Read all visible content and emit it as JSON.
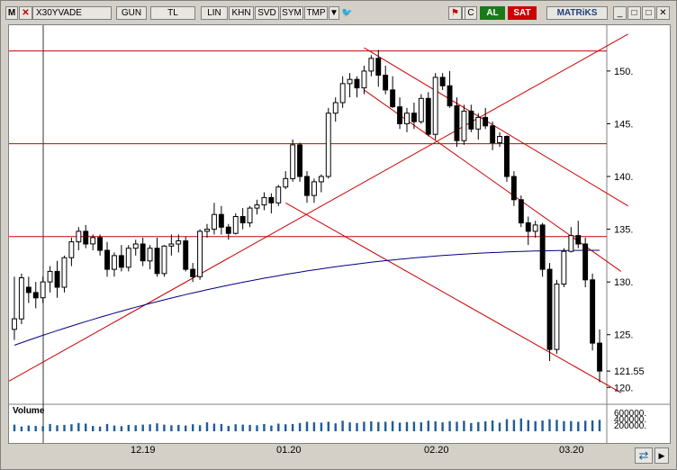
{
  "toolbar": {
    "menu_letter": "M",
    "symbol": "X30YVADE",
    "period": "GUN",
    "currency": "TL",
    "scale": "LIN",
    "btn_khn": "KHN",
    "btn_svd": "SVD",
    "btn_sym": "SYM",
    "btn_tmp": "TMP",
    "al_label": "AL",
    "sat_label": "SAT",
    "brand": "MATRiKS"
  },
  "colors": {
    "bullish": "#ffffff",
    "bearish": "#000000",
    "trendline": "#cc0000",
    "moving_average": "#000080",
    "volume": "#1f5c99",
    "al": "#1a7a1a",
    "sat": "#cc0000"
  },
  "price_axis": {
    "ticks": [
      "150.",
      "145.",
      "140.",
      "135.",
      "130.",
      "125.",
      "121.55",
      "120."
    ]
  },
  "volume_panel": {
    "label": "Volume",
    "ticks": [
      "600000.",
      "400000.",
      "200000."
    ]
  },
  "date_axis": {
    "labels": [
      "12.19",
      "01.20",
      "02.20",
      "03.20"
    ]
  },
  "chart_data": {
    "type": "candlestick",
    "title": "X30YVADE",
    "ylim": [
      119,
      154
    ],
    "ohlc": [
      [
        125.5,
        130.5,
        124.5,
        126.5
      ],
      [
        126.5,
        130.8,
        126,
        130.4
      ],
      [
        129.5,
        130.5,
        128,
        129
      ],
      [
        129,
        130,
        127.5,
        128.5
      ],
      [
        128.5,
        130.5,
        128,
        130
      ],
      [
        130,
        131.5,
        129,
        131
      ],
      [
        131,
        132,
        128.5,
        129.5
      ],
      [
        129.5,
        132.5,
        129,
        132.3
      ],
      [
        132.3,
        134.2,
        131.5,
        133.8
      ],
      [
        133.8,
        135.2,
        133,
        134.8
      ],
      [
        134.8,
        135.4,
        133.2,
        133.6
      ],
      [
        133.6,
        134.5,
        133,
        134.2
      ],
      [
        134.2,
        134.5,
        132.5,
        133
      ],
      [
        133,
        133.8,
        130.5,
        131.2
      ],
      [
        131.2,
        132.8,
        130.5,
        132.5
      ],
      [
        132.5,
        133.5,
        131,
        131.4
      ],
      [
        131.4,
        133.5,
        131,
        133.2
      ],
      [
        133.2,
        134,
        132.5,
        133.6
      ],
      [
        133.6,
        134.2,
        131.5,
        132
      ],
      [
        132,
        133.5,
        131.2,
        133.2
      ],
      [
        133.2,
        134.2,
        130.5,
        130.8
      ],
      [
        130.8,
        133.5,
        130.5,
        133.4
      ],
      [
        133.4,
        134.5,
        132.5,
        133.6
      ],
      [
        133.6,
        134.5,
        132.8,
        133.9
      ],
      [
        133.9,
        134.3,
        131,
        131.2
      ],
      [
        131.2,
        131.8,
        130,
        130.5
      ],
      [
        130.5,
        135,
        130.2,
        134.8
      ],
      [
        134.8,
        135.5,
        134.2,
        135
      ],
      [
        135,
        137.5,
        134.5,
        136.4
      ],
      [
        136.4,
        137.2,
        134.5,
        135.2
      ],
      [
        135.2,
        135.5,
        134,
        134.6
      ],
      [
        134.6,
        136.5,
        134.5,
        136.2
      ],
      [
        136.2,
        137,
        135,
        135.6
      ],
      [
        135.6,
        137.2,
        135.2,
        137
      ],
      [
        137,
        137.8,
        136.4,
        137.3
      ],
      [
        137.3,
        138.5,
        136.8,
        138
      ],
      [
        138,
        138.4,
        136.5,
        137.5
      ],
      [
        137.5,
        139.2,
        137.2,
        139
      ],
      [
        139,
        140.5,
        138.8,
        139.8
      ],
      [
        139.8,
        143.5,
        139.5,
        143
      ],
      [
        143,
        143.2,
        139.5,
        140
      ],
      [
        140,
        140.5,
        137.5,
        138.2
      ],
      [
        138.2,
        139.8,
        137.5,
        139.5
      ],
      [
        139.5,
        140.2,
        138.5,
        140
      ],
      [
        140,
        146.5,
        139.8,
        146
      ],
      [
        146,
        147.5,
        145.2,
        147
      ],
      [
        147,
        149.5,
        146.5,
        148.8
      ],
      [
        148.8,
        149.8,
        147.5,
        149.2
      ],
      [
        149.2,
        149.5,
        147.5,
        148.4
      ],
      [
        148.4,
        150.5,
        147.8,
        150
      ],
      [
        150,
        151.5,
        149.5,
        151.2
      ],
      [
        151.2,
        152,
        148.5,
        149.6
      ],
      [
        149.6,
        150.5,
        147.8,
        148.2
      ],
      [
        148.2,
        149.5,
        146.5,
        146.6
      ],
      [
        146.6,
        147.5,
        144.5,
        145
      ],
      [
        145,
        146.5,
        144.2,
        146
      ],
      [
        146,
        147,
        144.5,
        145.2
      ],
      [
        145.2,
        147.8,
        145,
        147.4
      ],
      [
        147.4,
        148,
        143.8,
        144
      ],
      [
        144,
        149.8,
        143.5,
        149.4
      ],
      [
        149.4,
        149.8,
        148.2,
        148.6
      ],
      [
        148.6,
        150,
        146.5,
        146.7
      ],
      [
        146.7,
        147.5,
        142.8,
        143.4
      ],
      [
        143.4,
        146.8,
        143,
        146.2
      ],
      [
        146.2,
        146.8,
        144.2,
        144.5
      ],
      [
        144.5,
        146,
        143.5,
        145.6
      ],
      [
        145.6,
        146.5,
        144.5,
        144.8
      ],
      [
        144.8,
        145.2,
        142.5,
        143.2
      ],
      [
        143.2,
        144.2,
        142.8,
        143.8
      ],
      [
        143.8,
        143.9,
        139.5,
        140
      ],
      [
        140,
        140.5,
        137.2,
        137.8
      ],
      [
        137.8,
        138.2,
        135.2,
        135.6
      ],
      [
        135.6,
        136.2,
        133.5,
        134.8
      ],
      [
        134.8,
        135.8,
        134.2,
        135.4
      ],
      [
        135.4,
        135.6,
        130.5,
        131.2
      ],
      [
        131.2,
        131.8,
        122.5,
        123.6
      ],
      [
        123.6,
        130.2,
        123.2,
        129.8
      ],
      [
        129.8,
        133.2,
        129.5,
        132.9
      ],
      [
        132.9,
        135.2,
        132.8,
        134.4
      ],
      [
        134.4,
        135.8,
        133.2,
        133.6
      ],
      [
        133.6,
        134.2,
        129.5,
        130.2
      ],
      [
        130.2,
        130.8,
        123.5,
        124.2
      ],
      [
        124.2,
        125.5,
        120.5,
        121.55
      ]
    ],
    "volume": [
      210000,
      150000,
      180000,
      170000,
      160000,
      230000,
      190000,
      200000,
      220000,
      260000,
      240000,
      170000,
      150000,
      230000,
      180000,
      160000,
      200000,
      190000,
      210000,
      220000,
      250000,
      210000,
      190000,
      200000,
      180000,
      220000,
      190000,
      280000,
      240000,
      230000,
      170000,
      220000,
      210000,
      200000,
      190000,
      230000,
      180000,
      240000,
      220000,
      230000,
      260000,
      300000,
      280000,
      270000,
      300000,
      250000,
      330000,
      280000,
      260000,
      300000,
      310000,
      290000,
      300000,
      320000,
      270000,
      290000,
      300000,
      280000,
      330000,
      310000,
      280000,
      320000,
      300000,
      330000,
      260000,
      290000,
      310000,
      340000,
      270000,
      380000,
      360000,
      400000,
      350000,
      320000,
      340000,
      380000,
      360000,
      320000,
      320000,
      300000,
      330000,
      340000,
      360000
    ],
    "moving_average_start": 124,
    "moving_average_end": 133,
    "horizontal_levels": [
      151.9,
      143.1,
      134.3
    ],
    "selected_price": 121.55
  }
}
